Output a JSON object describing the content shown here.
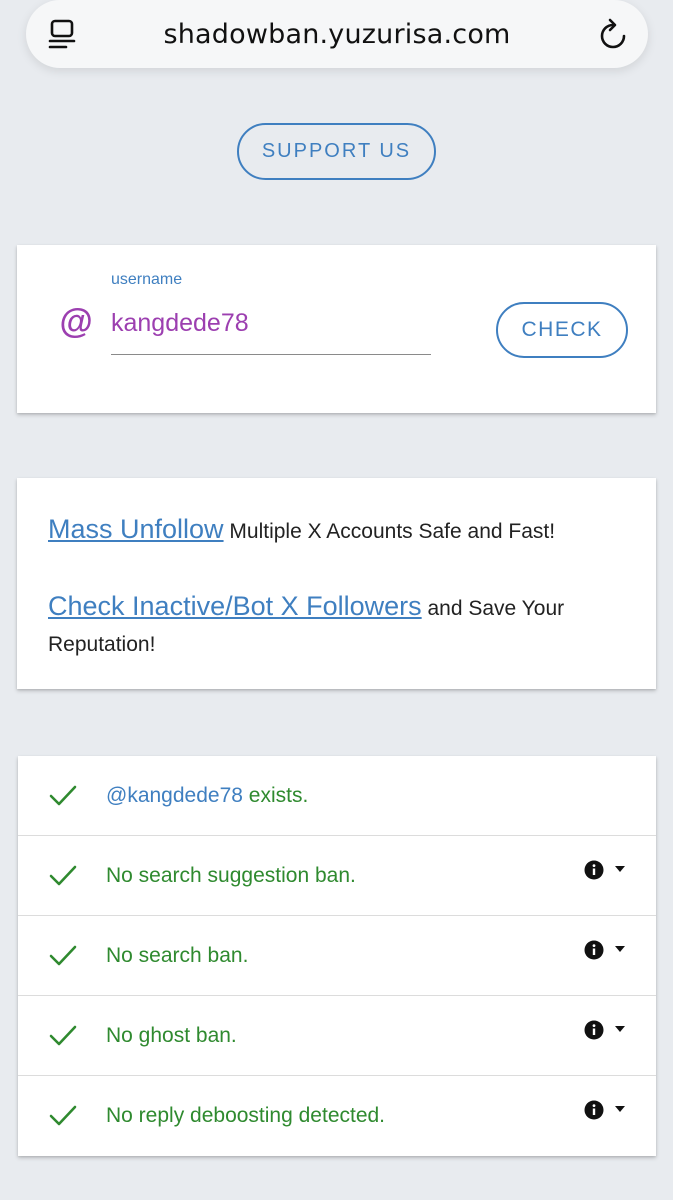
{
  "browser": {
    "url": "shadowban.yuzurisa.com"
  },
  "support_button": "SUPPORT US",
  "username_form": {
    "at_symbol": "@",
    "label": "username",
    "value": "kangdede78",
    "check_button": "CHECK"
  },
  "promo": {
    "link1": "Mass Unfollow",
    "text1": " Multiple X Accounts Safe and Fast!",
    "link2": "Check Inactive/Bot X Followers",
    "text2": " and Save Your Reputation!"
  },
  "results": [
    {
      "handle": "@kangdede78",
      "text": " exists.",
      "has_info": false
    },
    {
      "handle": "",
      "text": "No search suggestion ban.",
      "has_info": true
    },
    {
      "handle": "",
      "text": "No search ban.",
      "has_info": true
    },
    {
      "handle": "",
      "text": "No ghost ban.",
      "has_info": true
    },
    {
      "handle": "",
      "text": "No reply deboosting detected.",
      "has_info": true
    }
  ],
  "colors": {
    "accent_blue": "#3f7fc0",
    "purple": "#9c3fb0",
    "success_green": "#2f8a2f",
    "background": "#e8ebef"
  }
}
